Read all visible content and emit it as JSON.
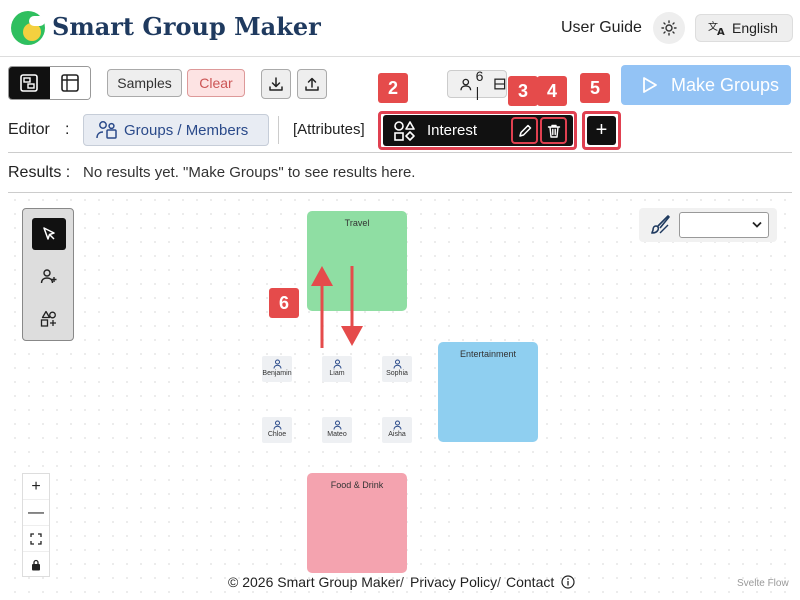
{
  "header": {
    "title": "Smart Group Maker",
    "user_guide": "User Guide",
    "language": "English"
  },
  "toolbar": {
    "samples_label": "Samples",
    "clear_label": "Clear",
    "member_count": "6 |",
    "make_groups_label": "Make Groups"
  },
  "editor": {
    "label": "Editor",
    "colon": ":",
    "groups_members_tab": "Groups / Members",
    "attributes_label": "[Attributes]",
    "attribute_name": "Interest",
    "add_symbol": "+"
  },
  "results": {
    "label": "Results :",
    "text": "No results yet. \"Make Groups\" to see results here."
  },
  "callouts": [
    "2",
    "3",
    "4",
    "5",
    "6"
  ],
  "canvas": {
    "groups": [
      {
        "name": "Travel",
        "color": "#8fdea3"
      },
      {
        "name": "Entertainment",
        "color": "#8fcff0"
      },
      {
        "name": "Food & Drink",
        "color": "#f4a3af"
      }
    ],
    "members": [
      "Benjamin",
      "Liam",
      "Sophia",
      "Chloe",
      "Mateo",
      "Aisha"
    ]
  },
  "zoom": {
    "zoom_in": "+",
    "zoom_out": "—"
  },
  "footer": {
    "copyright": "© 2026 Smart Group Maker",
    "separator": "/",
    "privacy": "Privacy Policy",
    "contact": "Contact",
    "attribution": "Svelte Flow"
  },
  "colors": {
    "accent": "#e54b4b",
    "title": "#1f3a5f",
    "make_groups_bg": "#93c3f5"
  }
}
